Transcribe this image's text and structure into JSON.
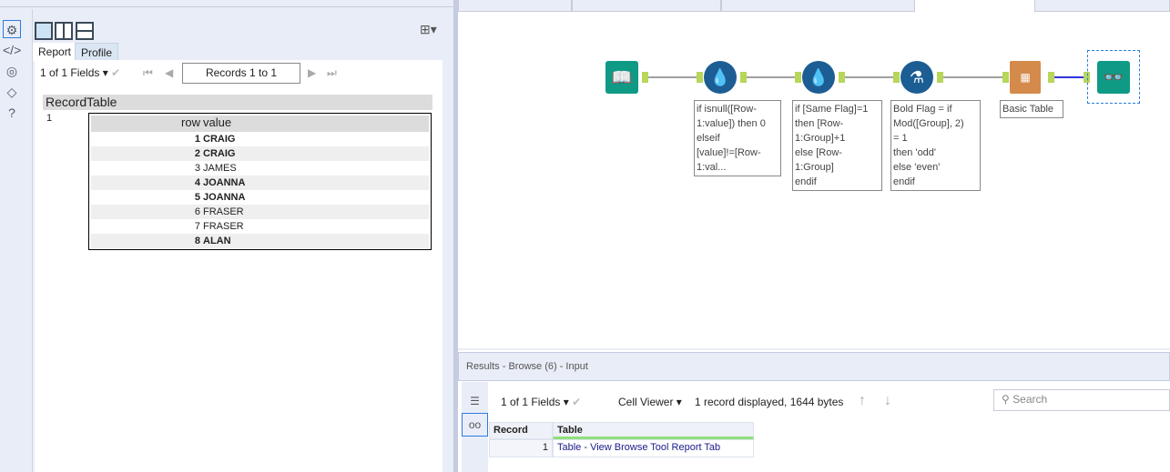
{
  "left_panel": {
    "sidebar_icons": [
      "gear-icon",
      "code-icon",
      "connection-icon",
      "tag-icon",
      "help-icon"
    ],
    "tabs": [
      "Report",
      "Profile"
    ],
    "fields_label": "1 of 1 Fields",
    "records_label": "Records 1 to 1",
    "outer_headers": [
      "Record",
      "Table"
    ],
    "record_num": "1",
    "inner_headers": [
      "row",
      "value"
    ],
    "rows": [
      {
        "row": "1",
        "value": "CRAIG",
        "bold": true
      },
      {
        "row": "2",
        "value": "CRAIG",
        "bold": true
      },
      {
        "row": "3",
        "value": "JAMES",
        "bold": false
      },
      {
        "row": "4",
        "value": "JOANNA",
        "bold": true
      },
      {
        "row": "5",
        "value": "JOANNA",
        "bold": true
      },
      {
        "row": "6",
        "value": "FRASER",
        "bold": false
      },
      {
        "row": "7",
        "value": "FRASER",
        "bold": false
      },
      {
        "row": "8",
        "value": "ALAN",
        "bold": true
      }
    ]
  },
  "workflow": {
    "annotations": [
      "if isnull([Row-\n1:value]) then 0\nelseif\n[value]!=[Row-\n1:val...",
      "if [Same Flag]=1\nthen [Row-\n1:Group]+1\nelse [Row-\n1:Group]\nendif",
      "Bold Flag = if\nMod([Group], 2)\n= 1\nthen 'odd'\nelse 'even'\nendif",
      "Basic Table"
    ]
  },
  "results": {
    "title": "Results - Browse (6) - Input",
    "fields_label": "1 of 1 Fields",
    "viewer_label": "Cell Viewer",
    "status": "1 record displayed, 1644 bytes",
    "search_placeholder": "Search",
    "headers": [
      "Record",
      "Table"
    ],
    "row": {
      "record": "1",
      "table": "Table - View Browse Tool Report Tab"
    }
  }
}
